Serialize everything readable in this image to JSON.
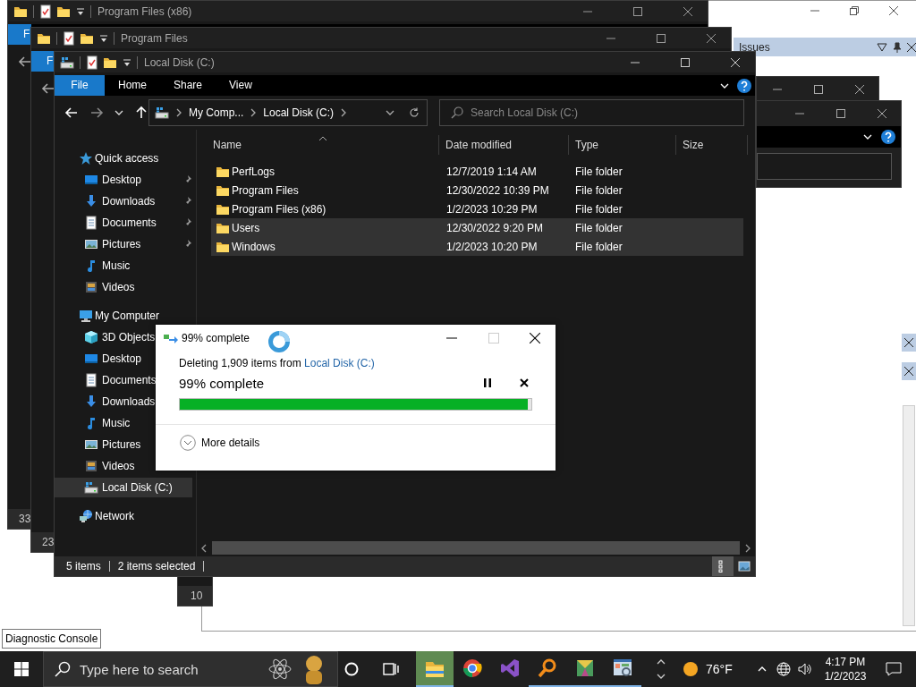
{
  "background_windows": [
    {
      "title": "Program Files (x86)",
      "file_tab": "F",
      "status": "33"
    },
    {
      "title": "Program Files",
      "file_tab": "F",
      "status": "23"
    }
  ],
  "back_window": {
    "status": "10"
  },
  "side_panel": {
    "title": "Issues"
  },
  "explorer": {
    "title": "Local Disk (C:)",
    "ribbon_tabs": [
      {
        "label": "File",
        "selected": true
      },
      {
        "label": "Home",
        "selected": false
      },
      {
        "label": "Share",
        "selected": false
      },
      {
        "label": "View",
        "selected": false
      }
    ],
    "address": [
      "My Comp...",
      "Local Disk (C:)"
    ],
    "search": {
      "placeholder": "Search Local Disk (C:)"
    },
    "navigation": [
      {
        "label": "Quick access",
        "kind": "star",
        "selected": false,
        "children": [
          {
            "label": "Desktop",
            "kind": "desktop",
            "pinned": true,
            "selected": false
          },
          {
            "label": "Downloads",
            "kind": "downloads",
            "pinned": true,
            "selected": false
          },
          {
            "label": "Documents",
            "kind": "documents",
            "pinned": true,
            "selected": false
          },
          {
            "label": "Pictures",
            "kind": "pictures",
            "pinned": true,
            "selected": false
          },
          {
            "label": "Music",
            "kind": "music",
            "pinned": false,
            "selected": false
          },
          {
            "label": "Videos",
            "kind": "videos",
            "pinned": false,
            "selected": false
          }
        ]
      },
      {
        "label": "My Computer",
        "kind": "computer",
        "selected": false,
        "children": [
          {
            "label": "3D Objects",
            "kind": "cube",
            "selected": false
          },
          {
            "label": "Desktop",
            "kind": "desktop",
            "selected": false
          },
          {
            "label": "Documents",
            "kind": "documents",
            "selected": false
          },
          {
            "label": "Downloads",
            "kind": "downloads",
            "selected": false
          },
          {
            "label": "Music",
            "kind": "music",
            "selected": false
          },
          {
            "label": "Pictures",
            "kind": "pictures",
            "selected": false
          },
          {
            "label": "Videos",
            "kind": "videos",
            "selected": false
          },
          {
            "label": "Local Disk (C:)",
            "kind": "disk",
            "selected": true
          }
        ]
      },
      {
        "label": "Network",
        "kind": "network",
        "selected": false
      }
    ],
    "columns": [
      {
        "label": "Name",
        "sorted": true
      },
      {
        "label": "Date modified",
        "sorted": false
      },
      {
        "label": "Type",
        "sorted": false
      },
      {
        "label": "Size",
        "sorted": false
      }
    ],
    "rows": [
      {
        "name": "PerfLogs",
        "date": "12/7/2019 1:14 AM",
        "type": "File folder",
        "selected": false
      },
      {
        "name": "Program Files",
        "date": "12/30/2022 10:39 PM",
        "type": "File folder",
        "selected": false
      },
      {
        "name": "Program Files (x86)",
        "date": "1/2/2023 10:29 PM",
        "type": "File folder",
        "selected": false
      },
      {
        "name": "Users",
        "date": "12/30/2022 9:20 PM",
        "type": "File folder",
        "selected": true
      },
      {
        "name": "Windows",
        "date": "1/2/2023 10:20 PM",
        "type": "File folder",
        "selected": true
      }
    ],
    "status": {
      "count": "5 items",
      "selection": "2 items selected"
    }
  },
  "dialog": {
    "title": "99% complete",
    "message": "Deleting 1,909 items from",
    "source": "Local Disk (C:)",
    "progress_text": "99% complete",
    "level": 0.99,
    "details": "More details"
  },
  "tooltip": "Diagnostic Console",
  "taskbar": {
    "search": {
      "placeholder": "Type here to search"
    },
    "apps": [
      {
        "kind": "explorer",
        "active": true,
        "running": true
      },
      {
        "kind": "browser",
        "active": false,
        "running": false
      },
      {
        "kind": "studio",
        "active": false,
        "running": false
      },
      {
        "kind": "magnifier",
        "active": false,
        "running": true
      },
      {
        "kind": "map",
        "active": false,
        "running": true
      },
      {
        "kind": "dashboard",
        "active": false,
        "running": true
      }
    ],
    "weather": "76°F",
    "time": "4:17 PM",
    "date": "1/2/2023"
  }
}
